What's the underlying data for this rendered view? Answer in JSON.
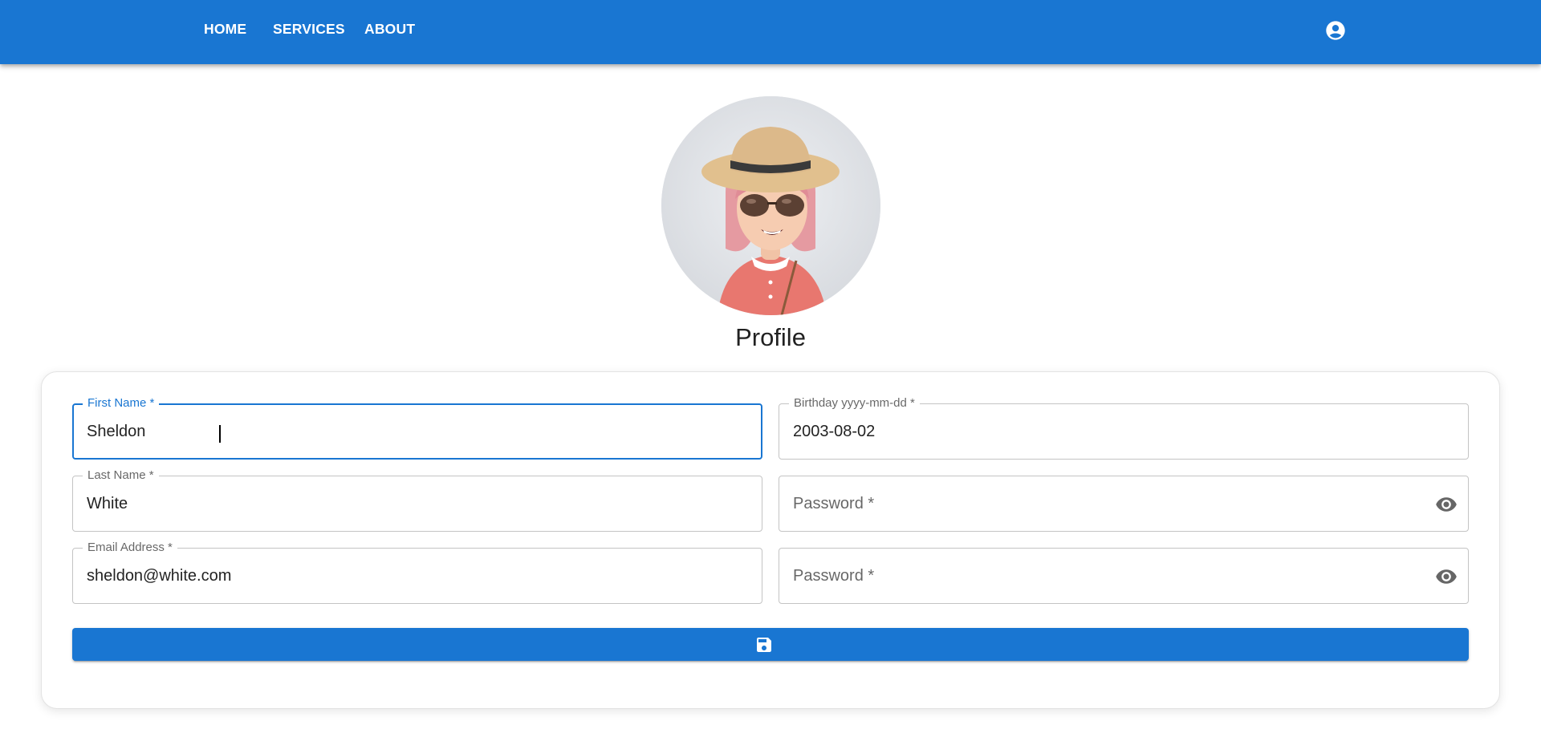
{
  "nav": {
    "home_label": "HOME",
    "services_label": "SERVICES",
    "about_label": "ABOUT",
    "account_icon": "account-circle-icon"
  },
  "profile": {
    "title": "Profile",
    "avatar": "cartoon-avatar-woman-with-hat-and-sunglasses"
  },
  "form": {
    "first_name": {
      "label": "First Name *",
      "value": "Sheldon"
    },
    "last_name": {
      "label": "Last Name *",
      "value": "White"
    },
    "email": {
      "label": "Email Address *",
      "value": "sheldon@white.com"
    },
    "birthday": {
      "label": "Birthday yyyy-mm-dd *",
      "value": "2003-08-02"
    },
    "password": {
      "placeholder": "Password *",
      "icon": "eye-icon"
    },
    "password_confirm": {
      "placeholder": "Password *",
      "icon": "eye-icon"
    },
    "save_icon": "floppy-disk-save-icon"
  },
  "colors": {
    "primary": "#1976d2",
    "border": "#c4c4c4"
  }
}
